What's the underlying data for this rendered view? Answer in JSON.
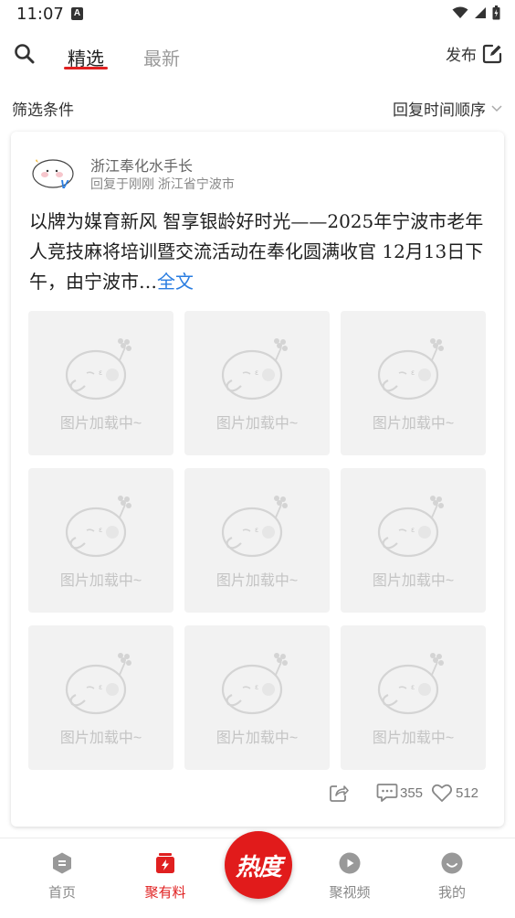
{
  "status_bar": {
    "time": "11:07",
    "notification_icon": "a-icon"
  },
  "top_nav": {
    "search_icon": "search-icon",
    "tabs": [
      {
        "label": "精选",
        "active": true
      },
      {
        "label": "最新",
        "active": false
      }
    ],
    "publish_label": "发布",
    "accent_color": "#e02020"
  },
  "filter": {
    "label": "筛选条件",
    "sort_value": "回复时间顺序"
  },
  "post": {
    "author": "浙江奉化水手长",
    "meta": "回复于刚刚  浙江省宁波市",
    "verified_mark": "V",
    "text": "以牌为媒育新风 智享银龄好时光——2025年宁波市老年人竞技麻将培训暨交流活动在奉化圆满收官 12月13日下午，由宁波市…",
    "read_more": "全文",
    "image_placeholder_text": "图片加载中~",
    "image_count": 9,
    "comments": "355",
    "likes": "512"
  },
  "bottom_tabs": [
    {
      "label": "首页",
      "icon": "home-icon",
      "active": false
    },
    {
      "label": "聚有料",
      "icon": "bolt-card-icon",
      "active": true
    },
    {
      "label": "热度",
      "icon": "hot-button",
      "active": false
    },
    {
      "label": "聚视频",
      "icon": "video-play-icon",
      "active": false
    },
    {
      "label": "我的",
      "icon": "profile-icon",
      "active": false
    }
  ],
  "colors": {
    "accent": "#e02020",
    "link": "#2a7de1"
  }
}
